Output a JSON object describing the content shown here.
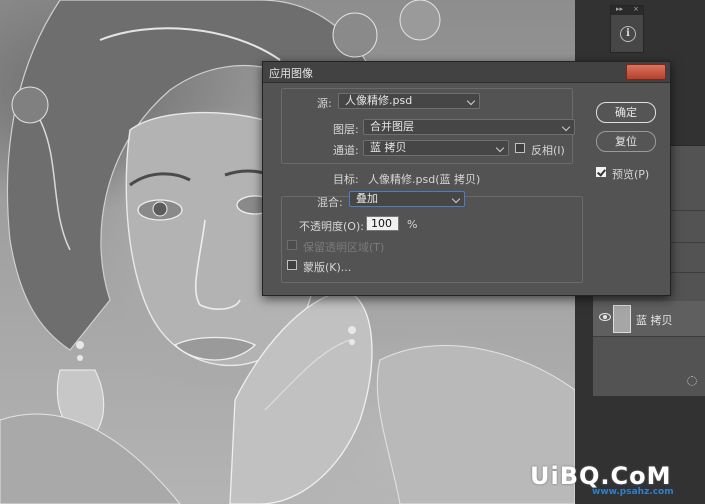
{
  "dialog": {
    "title": "应用图像",
    "source_label": "源:",
    "source_value": "人像精修.psd",
    "layer_label": "图层:",
    "layer_value": "合并图层",
    "channel_label": "通道:",
    "channel_value": "蓝 拷贝",
    "invert_label": "反相(I)",
    "invert_checked": false,
    "target_label": "目标:",
    "target_value": "人像精修.psd(蓝 拷贝)",
    "blending_label": "混合:",
    "blending_value": "叠加",
    "opacity_label": "不透明度(O):",
    "opacity_value": "100",
    "opacity_unit": "%",
    "preserve_transparency_label": "保留透明区域(T)",
    "preserve_transparency_enabled": false,
    "mask_label": "蒙版(K)...",
    "mask_checked": false,
    "ok_label": "确定",
    "reset_label": "复位",
    "preview_label": "预览(P)",
    "preview_checked": true
  },
  "layers_panel": {
    "active_layer_name": "蓝 拷贝",
    "active_layer_visible": true
  },
  "mini_panel": {
    "collapse_glyph": "▸▸",
    "close_glyph": "×",
    "info_glyph": "i"
  },
  "watermark": {
    "text": "UiBQ.CoM",
    "subtext": "www.psahz.com"
  },
  "colors": {
    "dialog_bg": "#535353",
    "titlebar_bg": "#424242",
    "close_button": "#c4503a",
    "focus_border": "#4a7fc8"
  }
}
